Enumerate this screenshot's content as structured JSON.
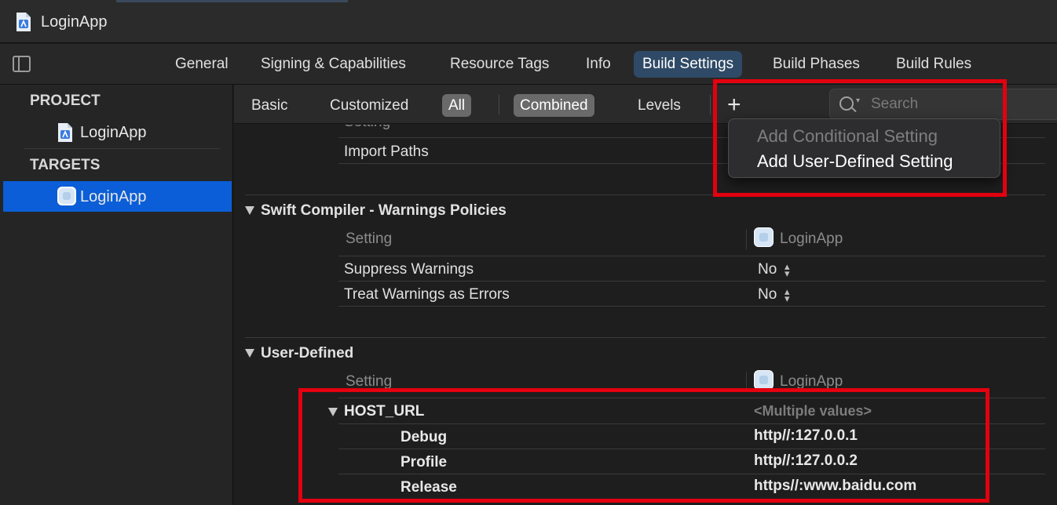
{
  "window": {
    "title": "LoginApp"
  },
  "tabs": [
    {
      "label": "General",
      "active": false
    },
    {
      "label": "Signing & Capabilities",
      "active": false
    },
    {
      "label": "Resource Tags",
      "active": false
    },
    {
      "label": "Info",
      "active": false
    },
    {
      "label": "Build Settings",
      "active": true
    },
    {
      "label": "Build Phases",
      "active": false
    },
    {
      "label": "Build Rules",
      "active": false
    }
  ],
  "sidebar": {
    "project_header": "PROJECT",
    "project_item": "LoginApp",
    "targets_header": "TARGETS",
    "target_item": "LoginApp"
  },
  "filters": {
    "basic": "Basic",
    "customized": "Customized",
    "all": "All",
    "combined": "Combined",
    "levels": "Levels",
    "add": "+",
    "search_placeholder": "Search"
  },
  "menu": {
    "add_conditional": "Add Conditional Setting",
    "add_user_defined": "Add User-Defined Setting"
  },
  "content": {
    "partial_header": "Setting",
    "import_paths": "Import Paths",
    "swift_section": {
      "title": "Swift Compiler - Warnings Policies",
      "setting_header": "Setting",
      "target_header": "LoginApp",
      "rows": [
        {
          "name": "Suppress Warnings",
          "value": "No"
        },
        {
          "name": "Treat Warnings as Errors",
          "value": "No"
        }
      ]
    },
    "user_section": {
      "title": "User-Defined",
      "setting_header": "Setting",
      "target_header": "LoginApp",
      "host": {
        "name": "HOST_URL",
        "value": "<Multiple values>"
      },
      "configs": [
        {
          "name": "Debug",
          "value": "http//:127.0.0.1"
        },
        {
          "name": "Profile",
          "value": "http//:127.0.0.2"
        },
        {
          "name": "Release",
          "value": "https//:www.baidu.com"
        }
      ]
    }
  },
  "colors": {
    "accent_tab": "#2f4a66",
    "sidebar_selection": "#0b5ed7",
    "highlight_box": "#e3000f"
  }
}
